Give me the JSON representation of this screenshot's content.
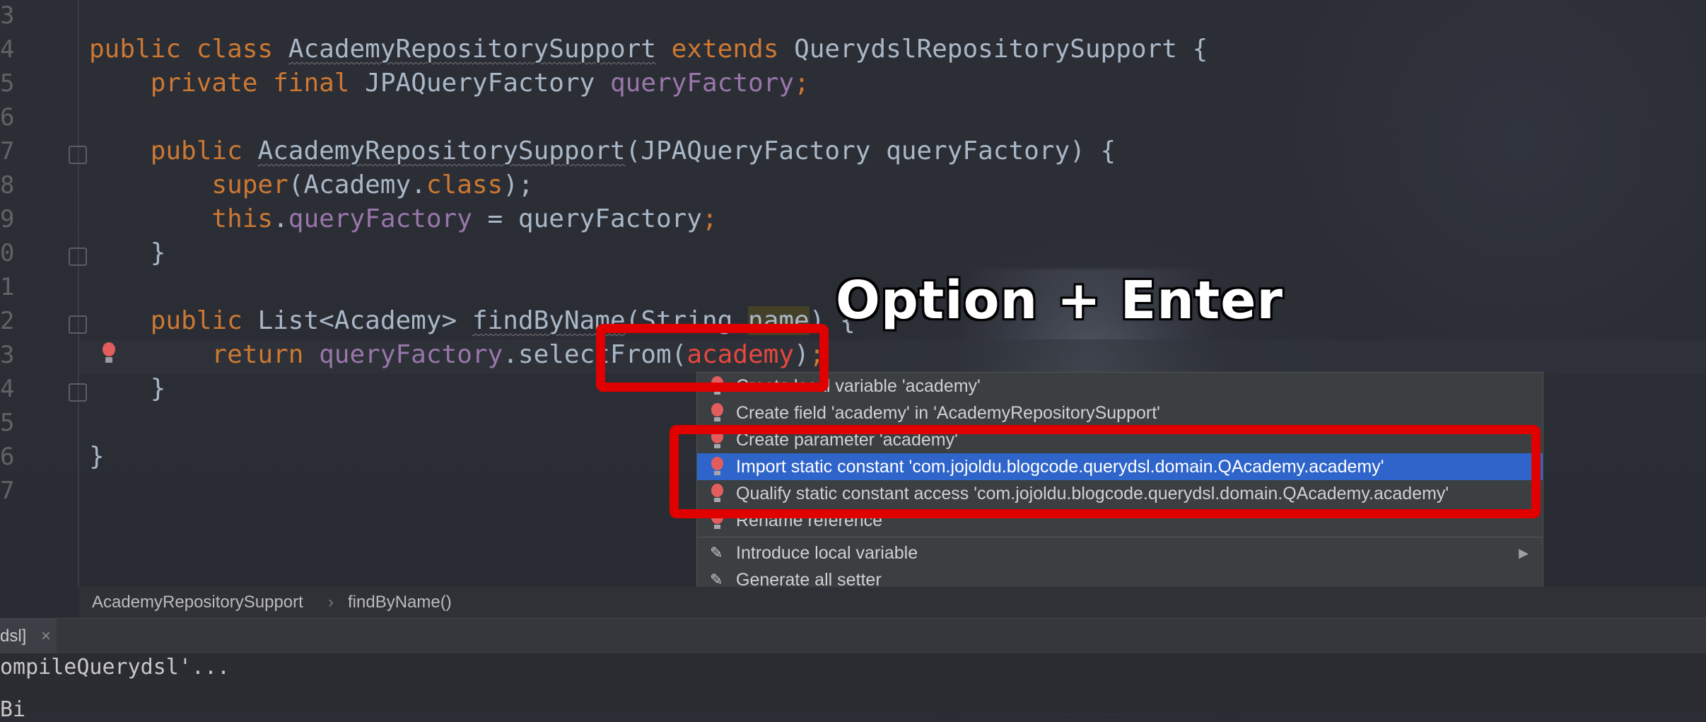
{
  "editor": {
    "line_numbers": [
      "3",
      "4",
      "5",
      "6",
      "7",
      "8",
      "9",
      "0",
      "1",
      "2",
      "3",
      "4",
      "5",
      "6",
      "7"
    ],
    "code": {
      "l4": {
        "public": "public",
        "class": "class",
        "classname": "AcademyRepositorySupport",
        "extends": "extends",
        "parent": "QuerydslRepositorySupport",
        "brace": " {"
      },
      "l5": {
        "private": "private",
        "final": "final",
        "type": "JPAQueryFactory",
        "field": "queryFactory",
        "semi": ";"
      },
      "l7": {
        "public": "public",
        "ctor": "AcademyRepositorySupport",
        "args": "(JPAQueryFactory queryFactory) {"
      },
      "l8": {
        "super": "super",
        "arg": "(Academy.",
        "cls": "class",
        "end": ");"
      },
      "l9": {
        "this": "this",
        "dot": ".",
        "field": "queryFactory",
        "rest": " = queryFactory",
        "semi": ";"
      },
      "l10": {
        "brace": "}"
      },
      "l12": {
        "public": "public",
        "ret": "List<Academy>",
        "method": "findByName",
        "open": "(String ",
        "param": "name",
        "close": ") {"
      },
      "l13": {
        "return": "return",
        "field": "queryFactory",
        "call": ".selectFrom(",
        "arg": "academy",
        "end": ")",
        "semi": ";"
      },
      "l14": {
        "brace": "}"
      },
      "l16": {
        "brace": "}"
      }
    }
  },
  "overlay": {
    "shortcut_text": "Option + Enter"
  },
  "intention_popup": {
    "items": [
      {
        "label": "Create local variable 'academy'"
      },
      {
        "label": "Create field 'academy' in 'AcademyRepositorySupport'"
      },
      {
        "label": "Create parameter 'academy'"
      },
      {
        "label": "Import static constant 'com.jojoldu.blogcode.querydsl.domain.QAcademy.academy'"
      },
      {
        "label": "Qualify static constant access 'com.jojoldu.blogcode.querydsl.domain.QAcademy.academy'"
      },
      {
        "label": "Rename reference"
      },
      {
        "label": "Introduce local variable"
      },
      {
        "label": "Generate all setter"
      }
    ],
    "selected_index": 3
  },
  "breadcrumb": {
    "class": "AcademyRepositorySupport",
    "sep": "›",
    "method": "findByName()"
  },
  "panel": {
    "tab_label": "dsl]",
    "close": "×"
  },
  "console": {
    "line1": "ompileQuerydsl'...",
    "line2": "Bi"
  },
  "colors": {
    "keyword": "#cc7832",
    "field": "#9876aa",
    "error": "#e5483e",
    "selection": "#2f65ca",
    "highlight_box": "#e00000"
  }
}
